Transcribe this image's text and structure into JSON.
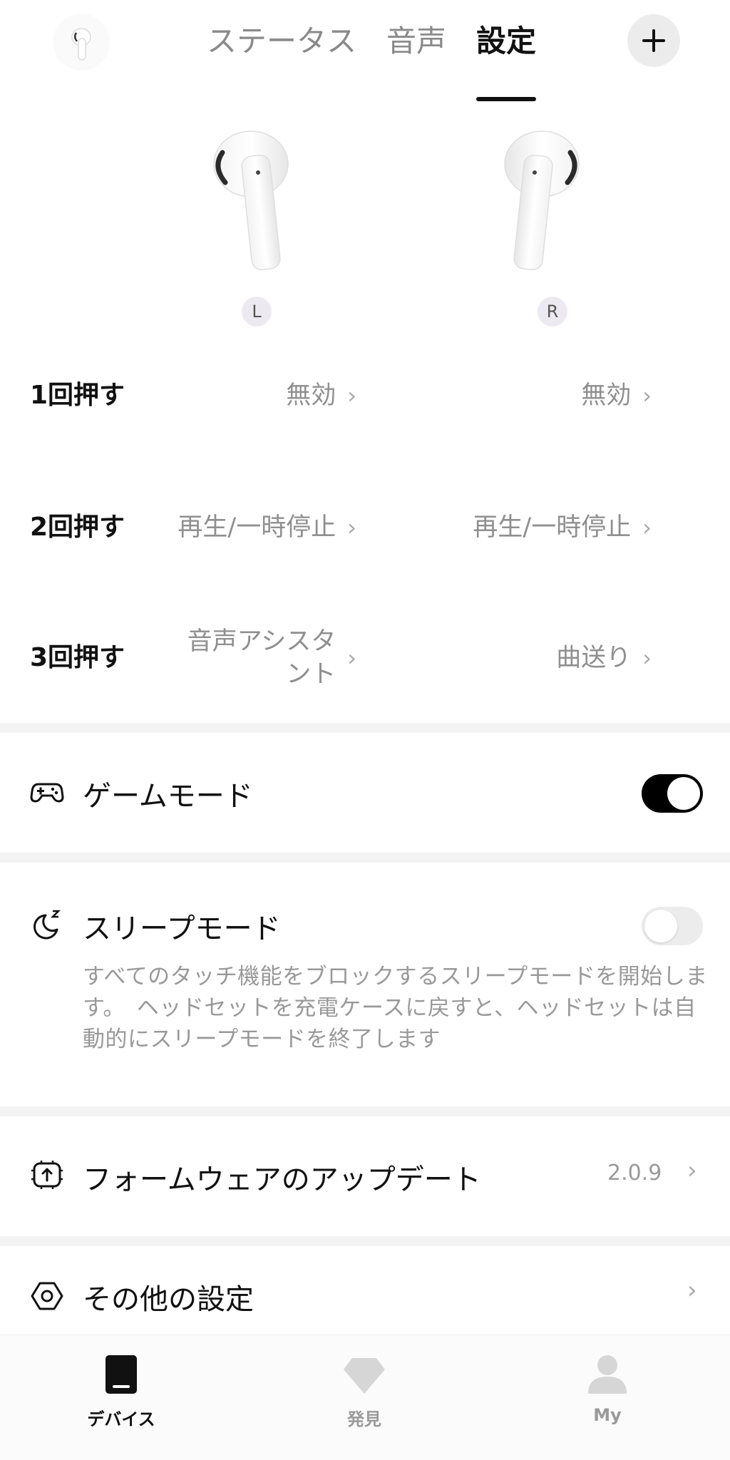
{
  "tabs": [
    {
      "label": "ステータス"
    },
    {
      "label": "音声"
    },
    {
      "label": "設定"
    }
  ],
  "active_tab": "設定",
  "earbuds": {
    "left_badge": "L",
    "right_badge": "R"
  },
  "press_settings": [
    {
      "label": "1回押す",
      "left": "無効",
      "right": "無効"
    },
    {
      "label": "2回押す",
      "left": "再生/一時停止",
      "right": "再生/一時停止"
    },
    {
      "label": "3回押す",
      "left": "音声アシスタント",
      "right": "曲送り"
    }
  ],
  "game_mode": {
    "title": "ゲームモード",
    "enabled": true
  },
  "sleep_mode": {
    "title": "スリープモード",
    "enabled": false,
    "description": "すべてのタッチ機能をブロックするスリープモードを開始します。　ヘッドセットを充電ケースに戻すと、ヘッドセットは自動的にスリープモードを終了します"
  },
  "firmware": {
    "title": "フォームウェアのアップデート",
    "version": "2.0.9"
  },
  "other_settings": {
    "title": "その他の設定"
  },
  "bottom_nav": [
    {
      "label": "デバイス",
      "icon": "device-icon"
    },
    {
      "label": "発見",
      "icon": "diamond-icon"
    },
    {
      "label": "My",
      "icon": "user-icon"
    }
  ],
  "colors": {
    "accent": "#000000",
    "muted_text": "#8f8f8f",
    "divider": "#f3f3f3"
  }
}
